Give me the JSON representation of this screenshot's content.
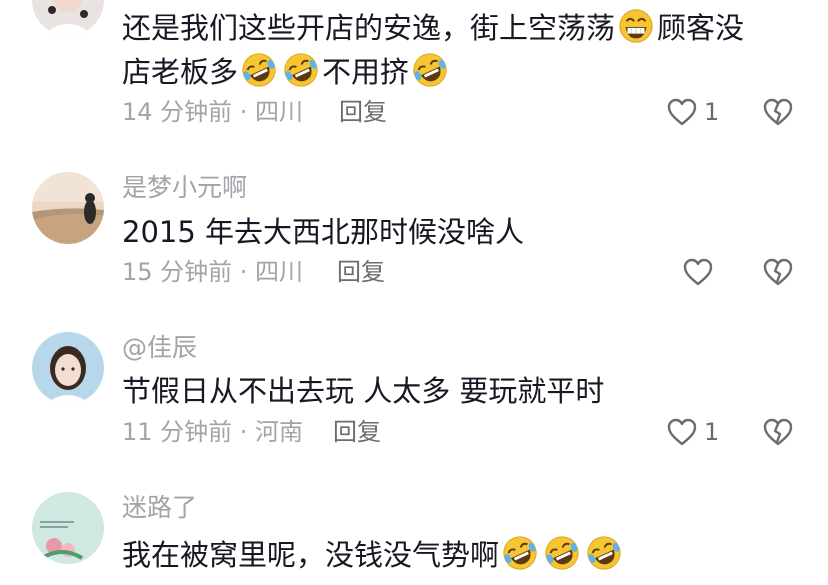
{
  "comments": [
    {
      "username": "",
      "text_line1_a": "还是我们这些开店的安逸，街上空荡荡",
      "text_line1_b": "顾客没",
      "text_line2_a": "店老板多",
      "text_line2_b": "不用挤",
      "time": "14 分钟前 · 四川",
      "reply": "回复",
      "likes": "1"
    },
    {
      "username": "是梦小元啊",
      "text": "2015 年去大西北那时候没啥人",
      "time": "15 分钟前 · 四川",
      "reply": "回复",
      "likes": ""
    },
    {
      "username": "@佳辰",
      "text": "节假日从不出去玩 人太多 要玩就平时",
      "time": "11 分钟前 · 河南",
      "reply": "回复",
      "likes": "1"
    },
    {
      "username": "迷路了",
      "text": "我在被窝里呢，没钱没气势啊",
      "time": "",
      "reply": "",
      "likes": ""
    }
  ],
  "icons": {
    "like": "heart-outline-icon",
    "dislike": "broken-heart-icon",
    "grin_emoji": "grinning-face-emoji",
    "laugh_emoji": "rofl-emoji"
  },
  "colors": {
    "text": "#161823",
    "meta": "#a3a3a8",
    "reply": "#6b6b70",
    "emoji": "#f7c531"
  }
}
